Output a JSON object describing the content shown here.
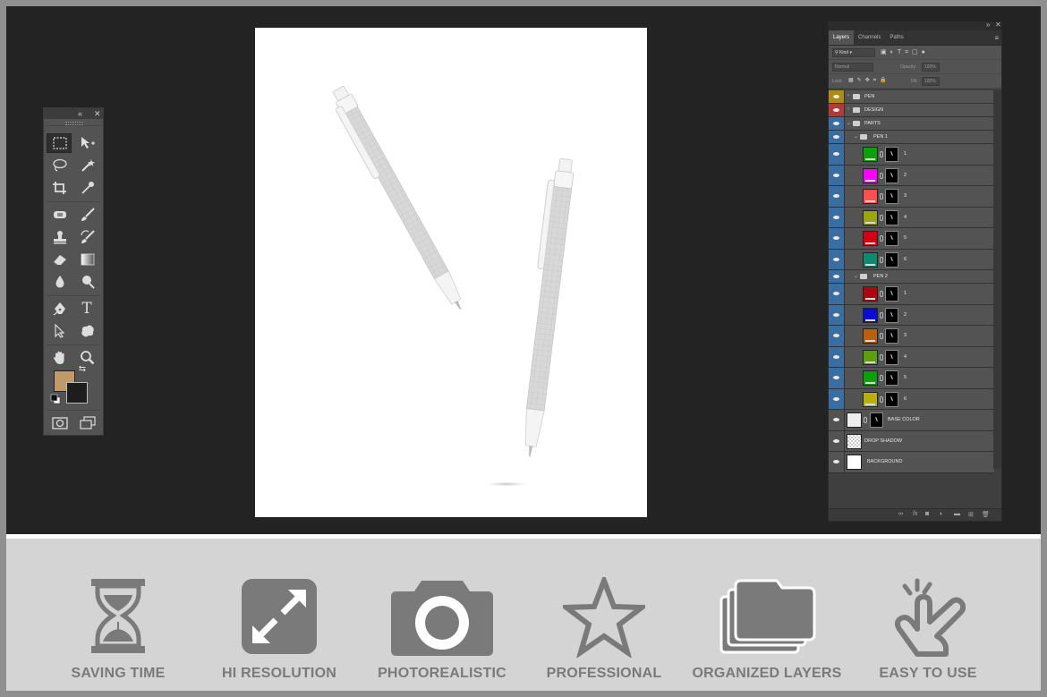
{
  "toolbox": {
    "collapse_icon": "double-chevron-left-icon",
    "close_icon": "close-icon",
    "tools": [
      {
        "name": "rectangular-marquee-icon"
      },
      {
        "name": "move-icon"
      },
      {
        "name": "lasso-icon"
      },
      {
        "name": "magic-wand-icon"
      },
      {
        "name": "crop-icon"
      },
      {
        "name": "eyedropper-icon"
      },
      {
        "name": "healing-brush-icon"
      },
      {
        "name": "brush-icon"
      },
      {
        "name": "clone-stamp-icon"
      },
      {
        "name": "history-brush-icon"
      },
      {
        "name": "eraser-icon"
      },
      {
        "name": "gradient-icon"
      },
      {
        "name": "blur-icon"
      },
      {
        "name": "dodge-icon"
      },
      {
        "name": "pen-tool-icon"
      },
      {
        "name": "type-tool-icon"
      },
      {
        "name": "path-selection-icon"
      },
      {
        "name": "custom-shape-icon"
      },
      {
        "name": "hand-tool-icon"
      },
      {
        "name": "zoom-tool-icon"
      }
    ],
    "type_glyph": "T",
    "foreground_color": "#c19a6b",
    "background_color": "#1d1d1d"
  },
  "layers_panel": {
    "tabs": [
      "Layers",
      "Channels",
      "Paths"
    ],
    "active_tab": "Layers",
    "filter_label": "Kind",
    "blend_mode": "Normal",
    "opacity_label": "Opacity:",
    "opacity_value": "100%",
    "lock_label": "Lock:",
    "fill_label": "Fill:",
    "fill_value": "100%",
    "groups": {
      "pen": "PEN",
      "design": "DESIGN",
      "parts": "PARTS",
      "pen1": "PEN 1",
      "pen2": "PEN 2"
    },
    "pen1_layers": [
      {
        "name": "1",
        "color": "#0aa00a"
      },
      {
        "name": "2",
        "color": "#ff00ff"
      },
      {
        "name": "3",
        "color": "#ff4f4f"
      },
      {
        "name": "4",
        "color": "#9aa60c"
      },
      {
        "name": "5",
        "color": "#d00010"
      },
      {
        "name": "6",
        "color": "#0b8c72"
      }
    ],
    "pen2_layers": [
      {
        "name": "1",
        "color": "#b00010"
      },
      {
        "name": "2",
        "color": "#0a0ad8"
      },
      {
        "name": "3",
        "color": "#b8600a"
      },
      {
        "name": "4",
        "color": "#5aa00a"
      },
      {
        "name": "5",
        "color": "#0aa00a"
      },
      {
        "name": "6",
        "color": "#b8b00a"
      }
    ],
    "base_color": "BASE COLOR",
    "drop_shadow": "DROP SHADOW",
    "background": "BACKGROUND"
  },
  "features": [
    {
      "label": "SAVING TIME",
      "icon": "hourglass-icon"
    },
    {
      "label": "HI RESOLUTION",
      "icon": "expand-arrows-icon"
    },
    {
      "label": "PHOTOREALISTIC",
      "icon": "camera-icon"
    },
    {
      "label": "PROFESSIONAL",
      "icon": "star-icon"
    },
    {
      "label": "ORGANIZED LAYERS",
      "icon": "stacked-folders-icon"
    },
    {
      "label": "EASY TO USE",
      "icon": "tap-hand-icon"
    }
  ]
}
